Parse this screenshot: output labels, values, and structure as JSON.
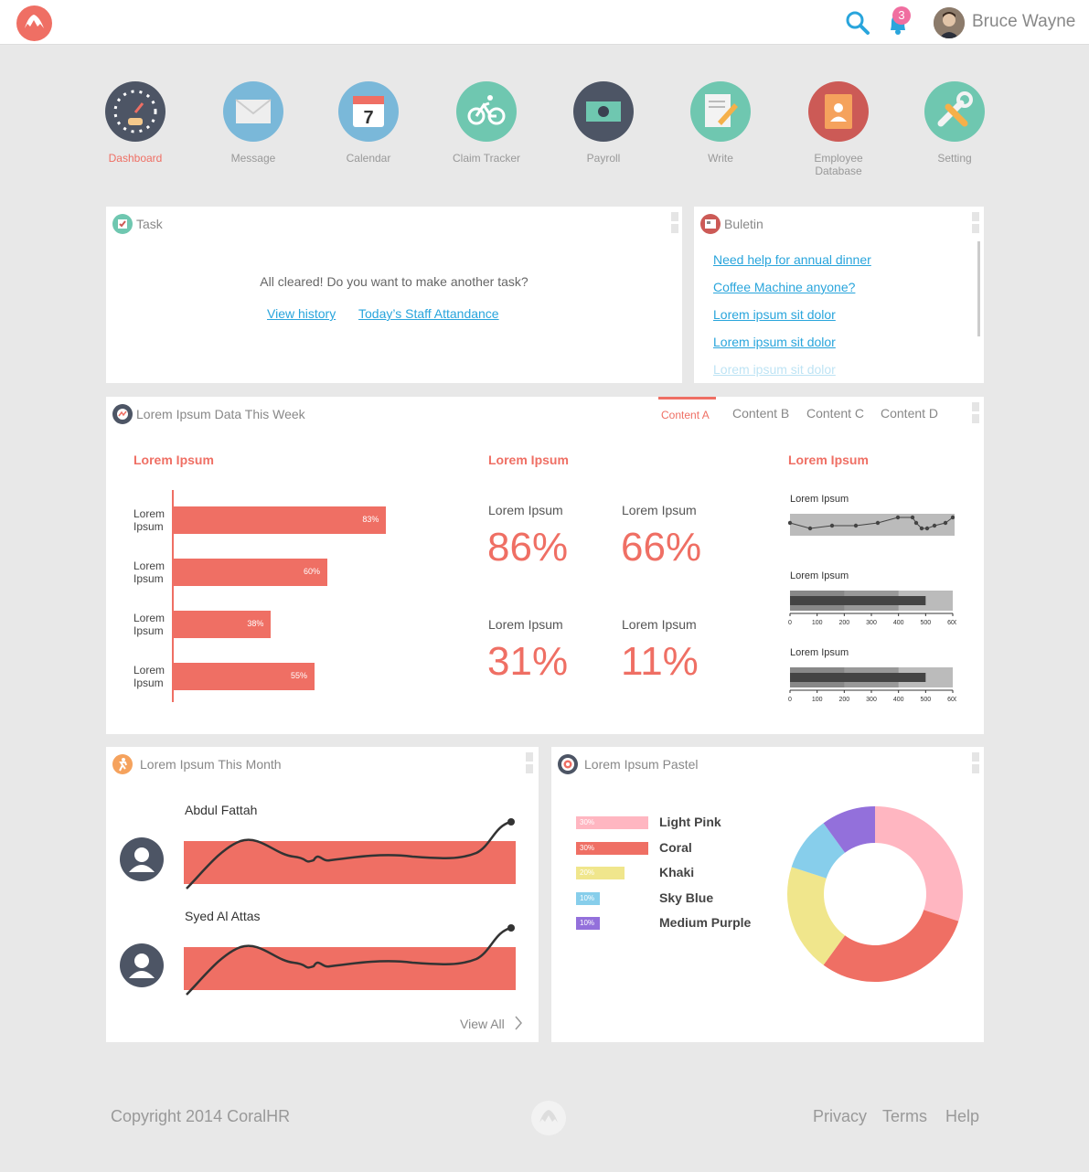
{
  "header": {
    "username": "Bruce Wayne",
    "notification_count": "3"
  },
  "nav": [
    {
      "label": "Dashboard",
      "active": true,
      "color": "#4d5565"
    },
    {
      "label": "Message",
      "color": "#7ab8d9"
    },
    {
      "label": "Calendar",
      "color": "#7ab8d9",
      "day": "7"
    },
    {
      "label": "Claim Tracker",
      "color": "#6fc7b0"
    },
    {
      "label": "Payroll",
      "color": "#4d5565"
    },
    {
      "label": "Write",
      "color": "#6fc7b0"
    },
    {
      "label": "Employee Database",
      "color": "#cc5a56"
    },
    {
      "label": "Setting",
      "color": "#6fc7b0"
    }
  ],
  "task": {
    "title": "Task",
    "message": "All cleared! Do you want to make another task?",
    "link1": "View history",
    "link2": "Today’s Staff Attandance"
  },
  "bulletin": {
    "title": "Buletin",
    "items": [
      "Need help for annual dinner",
      "Coffee Machine anyone?",
      "Lorem ipsum sit dolor",
      "Lorem ipsum sit dolor",
      "Lorem ipsum sit dolor"
    ]
  },
  "week": {
    "title": "Lorem Ipsum Data This Week",
    "tabs": [
      "Content A",
      "Content B",
      "Content C",
      "Content D"
    ],
    "section1": "Lorem Ipsum",
    "section2": "Lorem Ipsum",
    "section3": "Lorem Ipsum",
    "stats": [
      {
        "label": "Lorem Ipsum",
        "value": "86%"
      },
      {
        "label": "Lorem Ipsum",
        "value": "66%"
      },
      {
        "label": "Lorem Ipsum",
        "value": "31%"
      },
      {
        "label": "Lorem Ipsum",
        "value": "11%"
      }
    ],
    "mini": [
      "Lorem Ipsum",
      "Lorem Ipsum",
      "Lorem Ipsum"
    ],
    "ticks": [
      "0",
      "100",
      "200",
      "300",
      "400",
      "500",
      "600"
    ]
  },
  "chart_data": [
    {
      "type": "bar",
      "orientation": "horizontal",
      "categories": [
        "Lorem Ipsum",
        "Lorem Ipsum",
        "Lorem Ipsum",
        "Lorem Ipsum"
      ],
      "values": [
        83,
        60,
        38,
        55
      ],
      "labels": [
        "83%",
        "60%",
        "38%",
        "55%"
      ],
      "xlim": [
        0,
        100
      ],
      "color": "#ef6f64"
    },
    {
      "type": "line",
      "title": "Lorem Ipsum",
      "values": [
        4,
        2,
        3,
        3,
        4,
        6,
        6,
        4,
        2,
        2,
        3,
        4,
        6
      ]
    },
    {
      "type": "bar",
      "title": "Lorem Ipsum",
      "bullet_value": 500,
      "xlim": [
        0,
        600
      ]
    },
    {
      "type": "bar",
      "title": "Lorem Ipsum",
      "bullet_value": 500,
      "xlim": [
        0,
        600
      ]
    },
    {
      "type": "pie",
      "donut": true,
      "categories": [
        "Light Pink",
        "Coral",
        "Khaki",
        "Sky Blue",
        "Medium Purple"
      ],
      "values": [
        30,
        30,
        20,
        10,
        10
      ],
      "labels": [
        "30%",
        "30%",
        "20%",
        "10%",
        "10%"
      ],
      "colors": [
        "#ffb6c1",
        "#ef6f64",
        "#f0e68c",
        "#87ceeb",
        "#9370db"
      ]
    }
  ],
  "month": {
    "title": "Lorem Ipsum This Month",
    "people": [
      "Abdul Fattah",
      "Syed Al Attas"
    ],
    "view_all": "View All"
  },
  "pastel": {
    "title": "Lorem Ipsum Pastel"
  },
  "footer": {
    "copyright": "Copyright 2014 CoralHR",
    "privacy": "Privacy",
    "terms": "Terms",
    "help": "Help"
  }
}
